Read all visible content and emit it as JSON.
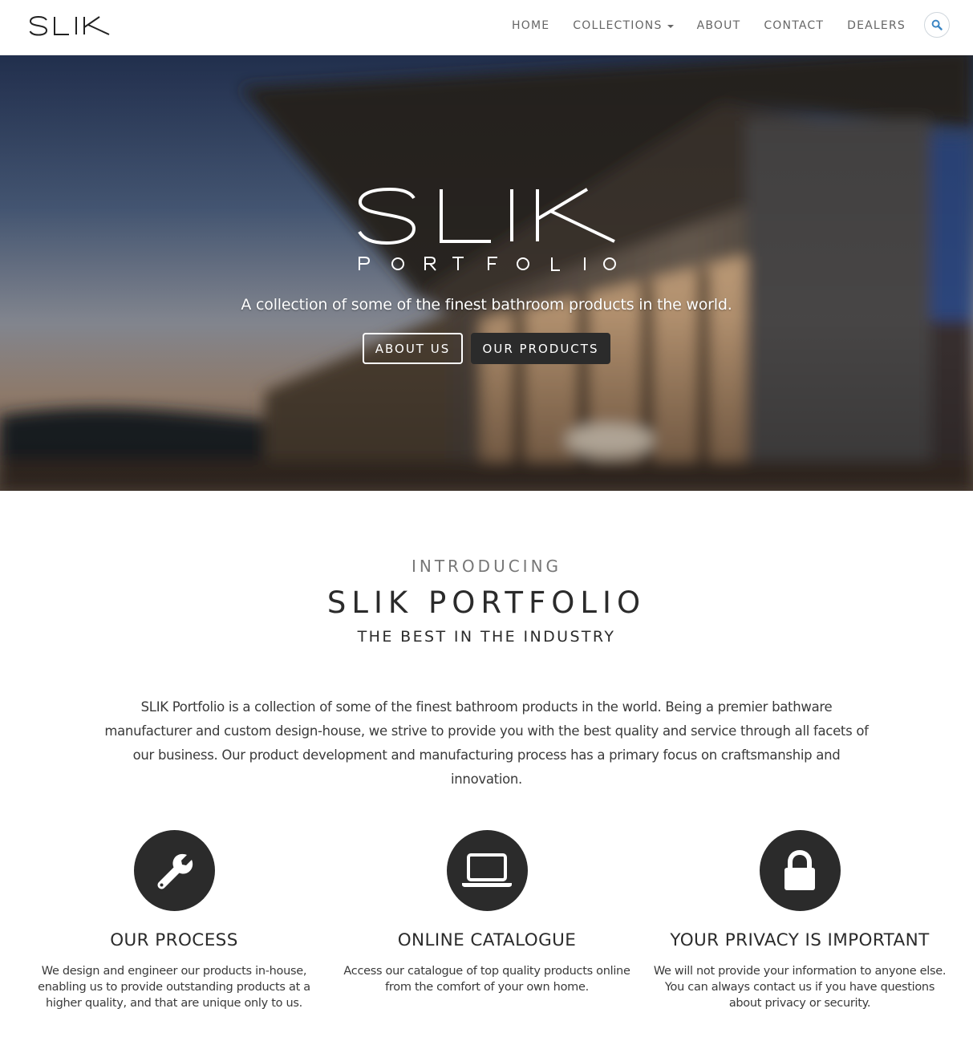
{
  "navbar": {
    "brand": "SLIK",
    "items": [
      {
        "label": "HOME"
      },
      {
        "label": "COLLECTIONS"
      },
      {
        "label": "ABOUT"
      },
      {
        "label": "CONTACT"
      },
      {
        "label": "DEALERS"
      }
    ],
    "search_icon": "search-icon",
    "accent_color": "#3b86c4"
  },
  "hero": {
    "logo_word": "SLIK",
    "logo_sub": "PORTFOLIO",
    "tagline": "A collection of some of the finest bathroom products in the world.",
    "buttons": {
      "about": "ABOUT US",
      "products": "OUR PRODUCTS"
    }
  },
  "intro": {
    "kicker": "INTRODUCING",
    "title": "SLIK PORTFOLIO",
    "subtitle": "THE BEST IN THE INDUSTRY",
    "body": "SLIK Portfolio is a collection of some of the finest bathroom products in the world. Being a premier bathware manufacturer and custom design-house, we strive to provide you with the best quality and service through all facets of our business. Our product development and manufacturing process has a primary focus on craftsmanship and innovation."
  },
  "features": [
    {
      "icon": "wrench-icon",
      "title": "OUR PROCESS",
      "text": "We design and engineer our products in-house, enabling us to provide outstanding products at a higher quality, and that are unique only to us."
    },
    {
      "icon": "laptop-icon",
      "title": "ONLINE CATALOGUE",
      "text": "Access our catalogue of top quality products online from the comfort of your own home."
    },
    {
      "icon": "lock-icon",
      "title": "YOUR PRIVACY IS IMPORTANT",
      "text": "We will not provide your information to anyone else. You can always contact us if you have questions about privacy or security."
    }
  ],
  "colors": {
    "dark": "#2b2b2b",
    "nav_text": "#666666"
  }
}
